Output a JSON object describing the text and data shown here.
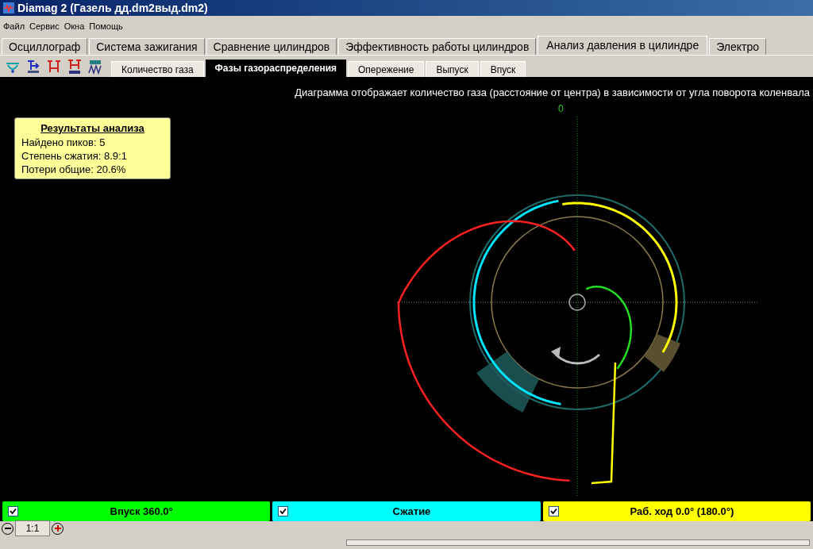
{
  "window": {
    "title": "Diamag 2 (Газель дд.dm2выд.dm2)"
  },
  "menu": [
    "Файл",
    "Сервис",
    "Окна",
    "Помощь"
  ],
  "tabs": [
    {
      "label": "Осциллограф",
      "selected": false
    },
    {
      "label": "Система зажигания",
      "selected": false
    },
    {
      "label": "Сравнение цилиндров",
      "selected": false
    },
    {
      "label": "Эффективность работы цилиндров",
      "selected": false
    },
    {
      "label": "Анализ давления в цилиндре",
      "selected": true
    },
    {
      "label": "Электро",
      "selected": false
    }
  ],
  "subtabs": [
    {
      "label": "Количество газа",
      "selected": false
    },
    {
      "label": "Фазы газораспределения",
      "selected": true
    },
    {
      "label": "Опережение",
      "selected": false
    },
    {
      "label": "Выпуск",
      "selected": false
    },
    {
      "label": "Впуск",
      "selected": false
    }
  ],
  "caption": "Диаграмма отображает количество газа (расстояние от центра) в зависимости от угла поворота коленвала",
  "results": {
    "title": "Результаты анализа",
    "lines": [
      "Найдено пиков: 5",
      "Степень сжатия: 8.9:1",
      "Потери общие: 20.6%"
    ]
  },
  "axis_label": "0",
  "phases": [
    {
      "label": "Впуск 360.0°",
      "checked": true,
      "color": "#00ff00"
    },
    {
      "label": "Сжатие",
      "checked": true,
      "color": "#00ffff"
    },
    {
      "label": "Раб. ход 0.0° (180.0°)",
      "checked": true,
      "color": "#ffff00"
    }
  ],
  "zoom": {
    "value": "1:1"
  }
}
